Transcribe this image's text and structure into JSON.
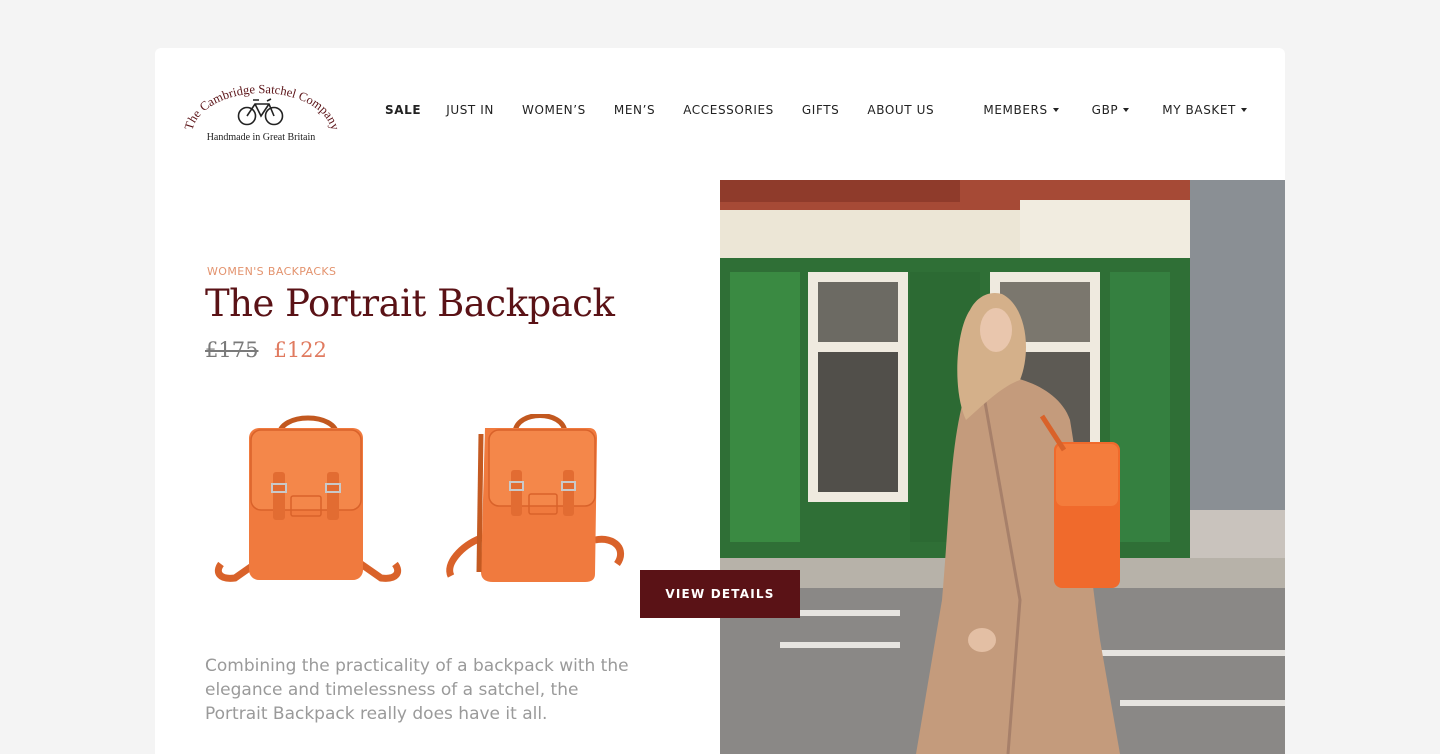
{
  "brand": {
    "name": "The Cambridge Satchel Company",
    "tagline": "Handmade in Great Britain",
    "logo_icon": "bicycle-icon"
  },
  "nav": {
    "items": [
      {
        "label": "SALE"
      },
      {
        "label": "JUST IN"
      },
      {
        "label": "WOMEN’S"
      },
      {
        "label": "MEN’S"
      },
      {
        "label": "ACCESSORIES"
      },
      {
        "label": "GIFTS"
      },
      {
        "label": "ABOUT US"
      }
    ]
  },
  "utility": {
    "members": "MEMBERS",
    "currency": "GBP",
    "basket": "MY BASKET",
    "dropdown_icon": "caret-down-icon"
  },
  "product": {
    "category": "WOMEN'S BACKPACKS",
    "title": "The Portrait Backpack",
    "price_old": "£175",
    "price_new": "£122",
    "cta": "VIEW DETAILS",
    "description": "Combining the practicality of a backpack with the elegance and timelessness of a satchel, the Portrait Backpack really does have it all."
  },
  "colors": {
    "brand_maroon": "#5a1216",
    "accent_orange": "#e07a5f",
    "bag_orange": "#f07a3e",
    "background": "#f4f4f4"
  }
}
